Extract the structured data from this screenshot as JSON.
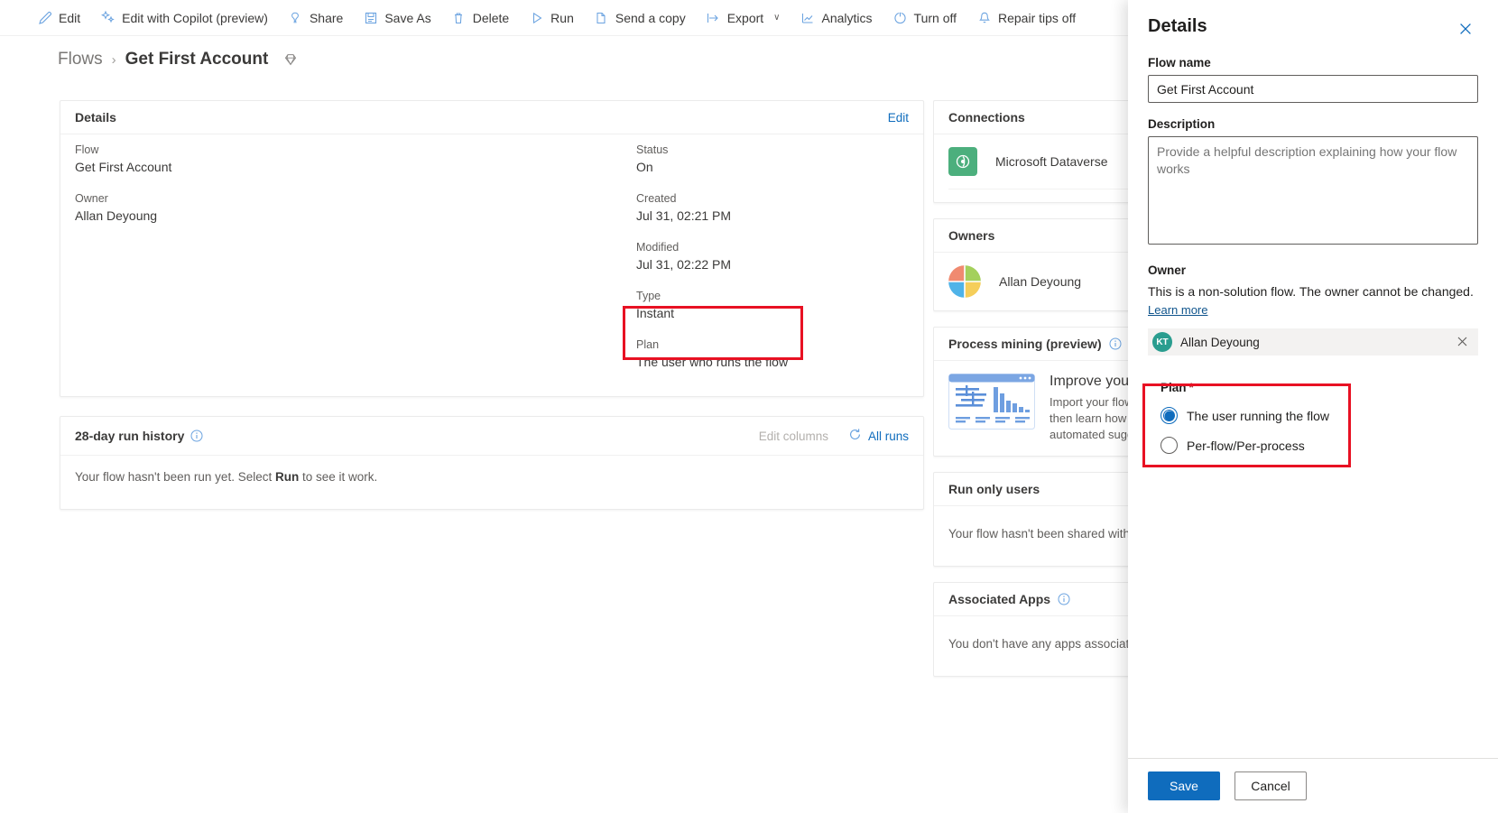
{
  "toolbar": {
    "items": [
      {
        "label": "Edit",
        "icon": "pencil-icon"
      },
      {
        "label": "Edit with Copilot (preview)",
        "icon": "copilot-icon"
      },
      {
        "label": "Share",
        "icon": "share-icon"
      },
      {
        "label": "Save As",
        "icon": "save-as-icon"
      },
      {
        "label": "Delete",
        "icon": "trash-icon"
      },
      {
        "label": "Run",
        "icon": "play-icon"
      },
      {
        "label": "Send a copy",
        "icon": "copy-icon"
      },
      {
        "label": "Export",
        "icon": "export-icon",
        "caret": "∨"
      },
      {
        "label": "Analytics",
        "icon": "analytics-icon"
      },
      {
        "label": "Turn off",
        "icon": "power-icon"
      },
      {
        "label": "Repair tips off",
        "icon": "bell-icon"
      }
    ]
  },
  "breadcrumb": {
    "parent": "Flows",
    "separator": "›",
    "current": "Get First Account"
  },
  "details_card": {
    "title": "Details",
    "edit_label": "Edit",
    "left_fields": [
      {
        "label": "Flow",
        "value": "Get First Account"
      },
      {
        "label": "Owner",
        "value": "Allan Deyoung"
      }
    ],
    "right_fields": [
      {
        "label": "Status",
        "value": "On"
      },
      {
        "label": "Created",
        "value": "Jul 31, 02:21 PM"
      },
      {
        "label": "Modified",
        "value": "Jul 31, 02:22 PM"
      },
      {
        "label": "Type",
        "value": "Instant"
      },
      {
        "label": "Plan",
        "value": "The user who runs the flow"
      }
    ]
  },
  "run_history": {
    "title": "28-day run history",
    "edit_columns_label": "Edit columns",
    "all_runs_label": "All runs",
    "empty_prefix": "Your flow hasn't been run yet. Select ",
    "empty_bold": "Run",
    "empty_suffix": " to see it work."
  },
  "side_cards": {
    "connections": {
      "title": "Connections",
      "connection_name": "Microsoft Dataverse"
    },
    "owners": {
      "title": "Owners",
      "owner_name": "Allan Deyoung"
    },
    "process_mining": {
      "title": "Process mining (preview)",
      "heading": "Improve your flow",
      "description": "Import your flow into a process, then learn how to improve it with automated suggestions."
    },
    "run_only_users": {
      "title": "Run only users",
      "empty": "Your flow hasn't been shared with anyone."
    },
    "associated_apps": {
      "title": "Associated Apps",
      "empty": "You don't have any apps associated."
    }
  },
  "flyout": {
    "title": "Details",
    "close_icon": "close-icon",
    "flow_name_label": "Flow name",
    "flow_name_value": "Get First Account",
    "description_label": "Description",
    "description_placeholder": "Provide a helpful description explaining how your flow works",
    "owner_label": "Owner",
    "owner_note": "This is a non-solution flow. The owner cannot be changed.",
    "learn_more_label": "Learn more",
    "persona_initials": "KT",
    "persona_name": "Allan Deyoung",
    "persona_remove_icon": "close-icon",
    "plan_label": "Plan",
    "plan_required_marker": "*",
    "plan_options": [
      {
        "label": "The user running the flow",
        "selected": true
      },
      {
        "label": "Per-flow/Per-process",
        "selected": false
      }
    ],
    "save_label": "Save",
    "cancel_label": "Cancel"
  },
  "colors": {
    "accent": "#0f6cbd",
    "annotation": "#e81123",
    "dataverse_green": "#4caf7d",
    "persona_teal": "#2a9d8f"
  }
}
